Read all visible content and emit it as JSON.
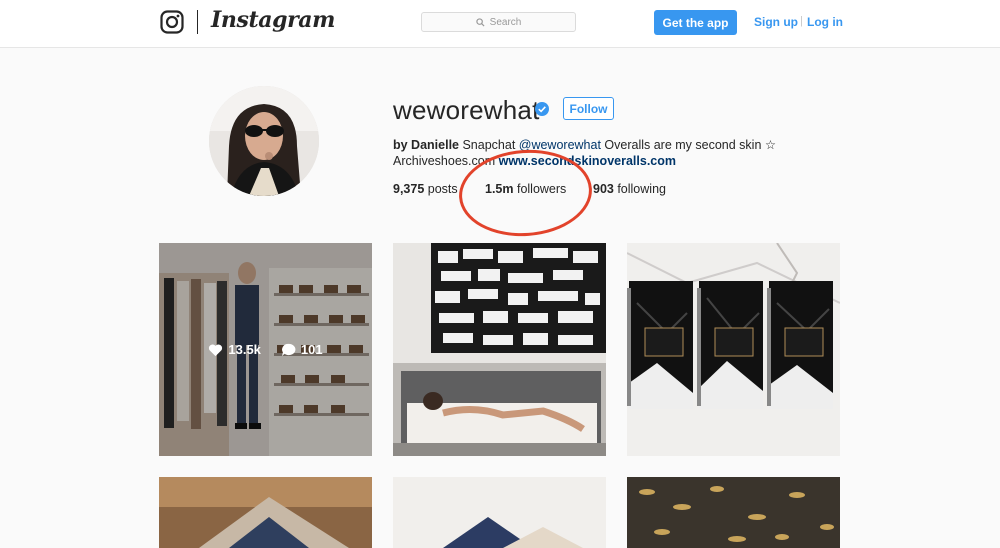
{
  "nav": {
    "wordmark": "Instagram",
    "search_placeholder": "Search",
    "get_app_label": "Get the app",
    "sign_up_label": "Sign up",
    "separator": "|",
    "log_in_label": "Log in"
  },
  "profile": {
    "username": "weworewhat",
    "follow_label": "Follow",
    "bio": {
      "name": "by Danielle",
      "text1": " Snapchat ",
      "mention": "@weworewhat",
      "text2": " Overalls are my second skin ☆",
      "line2_text": "Archiveshoes.com ",
      "link": "www.secondskinoveralls.com"
    },
    "stats": {
      "posts_count": "9,375",
      "posts_label": " posts",
      "followers_count": "1.5m",
      "followers_label": " followers",
      "following_count": "903",
      "following_label": " following"
    }
  },
  "posts": {
    "hover": {
      "likes": "13.5k",
      "comments": "101"
    }
  },
  "colors": {
    "accent": "#3897f0",
    "link": "#003569",
    "annotation": "#e2432b"
  }
}
